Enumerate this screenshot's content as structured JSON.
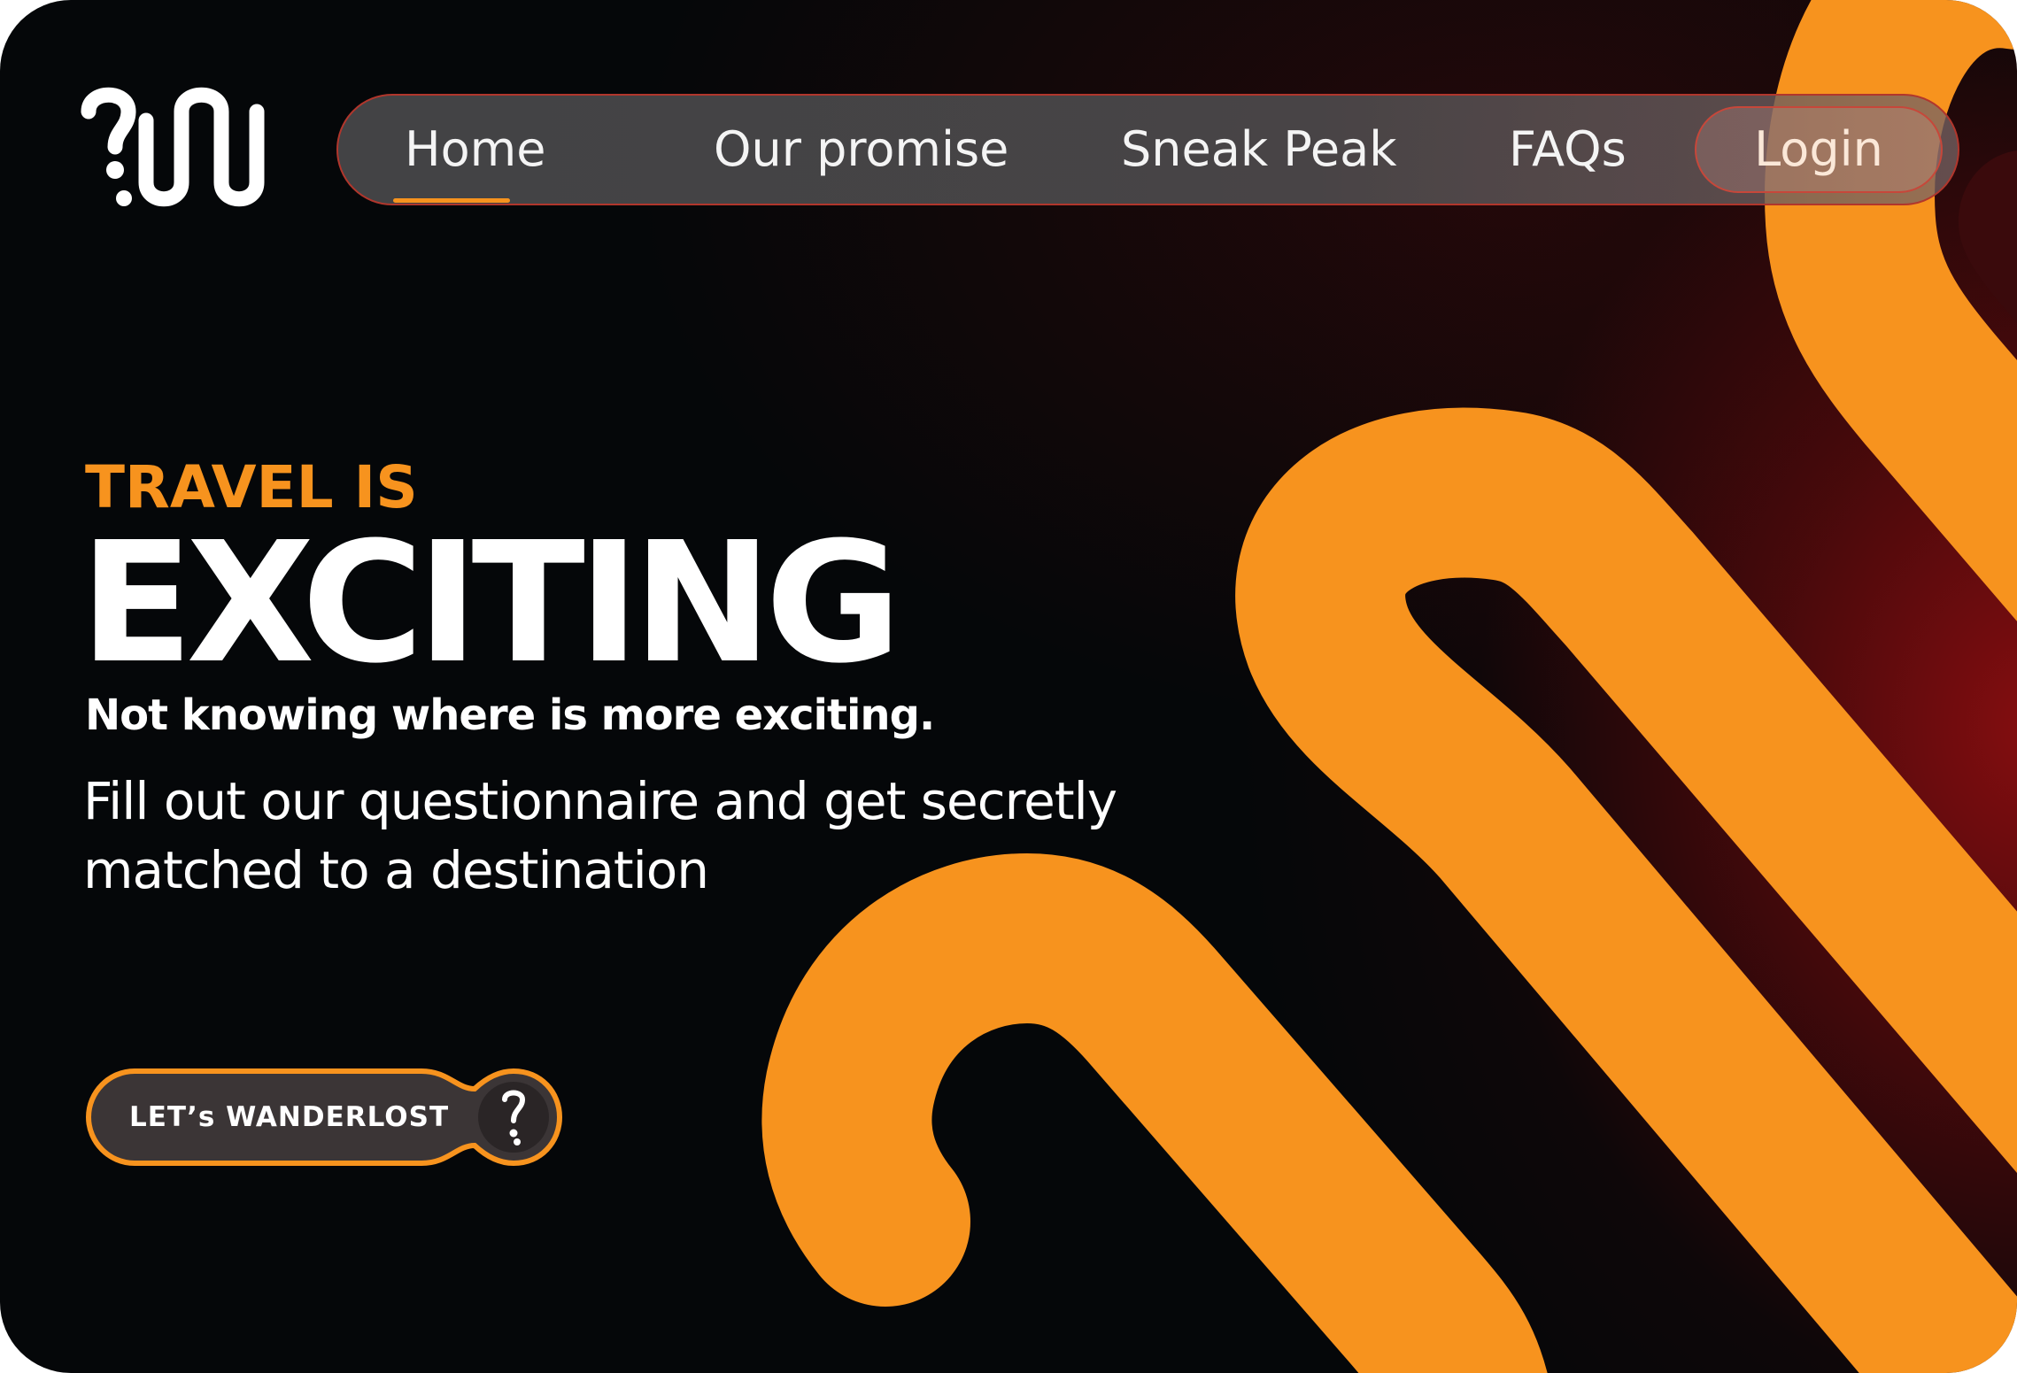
{
  "brand": {
    "logo_icon": "wanderlost-wave-question-logo",
    "accent_color": "#f7931e",
    "background_color": "#050709",
    "glow_color": "#8c0e10"
  },
  "nav": {
    "items": [
      {
        "label": "Home",
        "active": true
      },
      {
        "label": "Our promise"
      },
      {
        "label": "Sneak Peak"
      },
      {
        "label": "FAQs"
      }
    ],
    "login_label": "Login"
  },
  "hero": {
    "kicker": "TRAVEL IS",
    "title": "EXCITING",
    "subtitle": "Not knowing where is more exciting.",
    "body": "Fill out our questionnaire  and get secretly matched to a destination"
  },
  "cta": {
    "label": "LET’s WANDERLOST",
    "icon": "question-mark-icon"
  }
}
